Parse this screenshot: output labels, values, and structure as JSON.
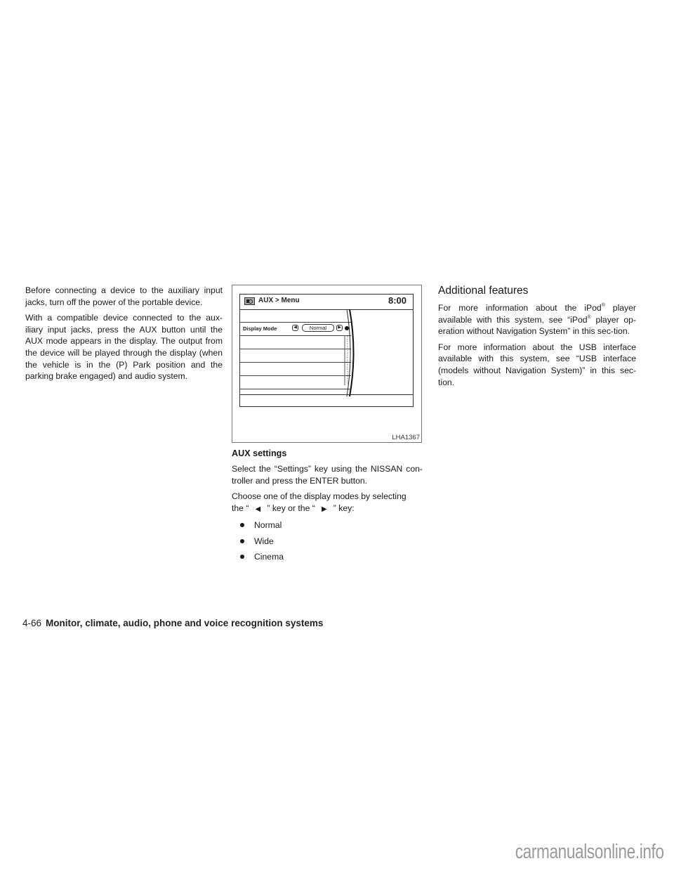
{
  "column1": {
    "paragraphs": [
      "Before connecting a device to the auxiliary input jacks, turn off the power of the portable device.",
      "With a compatible device connected to the aux-iliary input jacks, press the AUX button until the AUX mode appears in the display. The output from the device will be played through the display (when the vehicle is in the (P) Park position and the parking brake engaged) and audio system."
    ]
  },
  "figure": {
    "screen_title": "AUX > Menu",
    "clock": "8:00",
    "setting_label": "Display Mode",
    "setting_value": "Normal",
    "left_arrow": "◀",
    "right_arrow": "▶",
    "figure_code": "LHA1367",
    "icon": "aux-source-icon"
  },
  "column2": {
    "heading": "AUX settings",
    "p1": "Select the “Settings” key using the NISSAN con-troller and press the ENTER button.",
    "p2_line1": "Choose one of the display modes by selecting",
    "p2_the": "the “",
    "p2_left_key": "◀",
    "p2_mid": "” key or the “",
    "p2_right_key": "▶",
    "p2_end": "” key:",
    "modes": [
      "Normal",
      "Wide",
      "Cinema"
    ]
  },
  "column3": {
    "heading": "Additional features",
    "p1_a": "For more information about the iPod",
    "reg": "®",
    "p1_b": " player available with this system, see “iPod",
    "p1_c": " player op-eration without Navigation System” in this sec-tion.",
    "p2": "For more information about the USB interface available with this system, see “USB interface (models without Navigation System)” in this sec-tion."
  },
  "footer": {
    "page_number": "4-66",
    "section_title": "Monitor, climate, audio, phone and voice recognition systems"
  },
  "watermark": "carmanualsonline.info"
}
